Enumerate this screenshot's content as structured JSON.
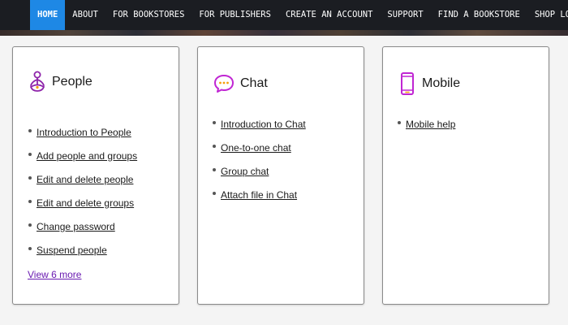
{
  "nav": {
    "items": [
      {
        "label": "HOME"
      },
      {
        "label": "ABOUT"
      },
      {
        "label": "FOR BOOKSTORES"
      },
      {
        "label": "FOR PUBLISHERS"
      },
      {
        "label": "CREATE AN ACCOUNT"
      },
      {
        "label": "SUPPORT"
      },
      {
        "label": "FIND A BOOKSTORE"
      },
      {
        "label": "SHOP LOCAL"
      }
    ],
    "active_color": "#1e88e5",
    "background_color": "#1b1d22"
  },
  "cards": [
    {
      "title": "People",
      "icon": "person-meditation-icon",
      "icon_color": "#8e24aa",
      "links": [
        "Introduction to People",
        "Add people and groups",
        "Edit and delete people",
        "Edit and delete groups",
        "Change password",
        "Suspend people"
      ],
      "more": "View 6 more"
    },
    {
      "title": "Chat",
      "icon": "chat-bubble-icon",
      "icon_color": "#c026d3",
      "links": [
        "Introduction to Chat",
        "One-to-one chat",
        "Group chat",
        "Attach file in Chat"
      ]
    },
    {
      "title": "Mobile",
      "icon": "mobile-phone-icon",
      "icon_color": "#c026d3",
      "links": [
        "Mobile help"
      ]
    }
  ]
}
